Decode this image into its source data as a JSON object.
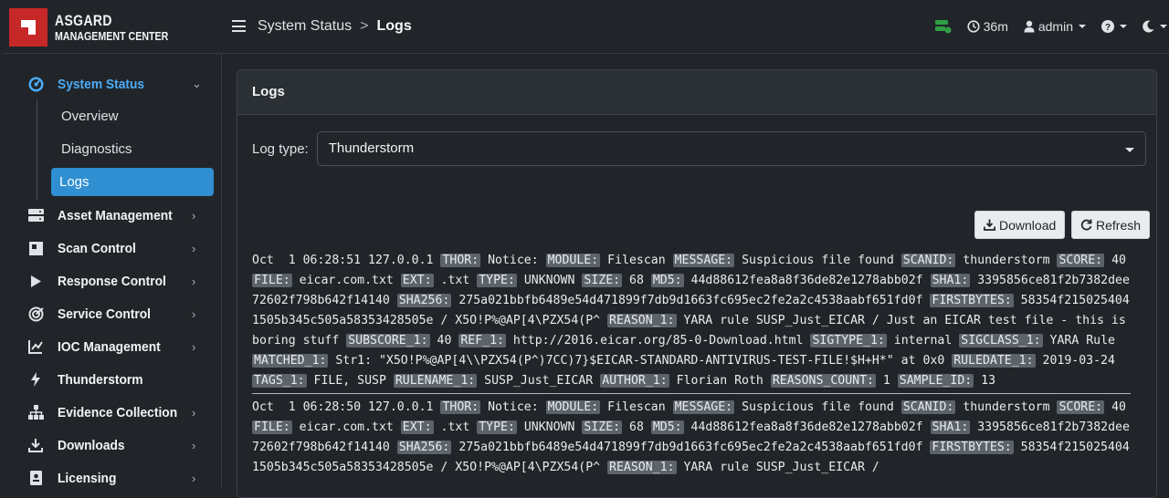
{
  "brand": {
    "line1": "ASGARD",
    "line2": "MANAGEMENT CENTER",
    "color": "#c62828"
  },
  "breadcrumb": {
    "parent": "System Status",
    "separator": ">",
    "current": "Logs"
  },
  "topbar": {
    "session_time": "36m",
    "user": "admin"
  },
  "sidebar": {
    "system_status": {
      "label": "System Status",
      "icon": "dashboard-icon"
    },
    "sub_items": [
      "Overview",
      "Diagnostics",
      "Logs"
    ],
    "items": [
      {
        "label": "Asset Management",
        "icon": "server-icon"
      },
      {
        "label": "Scan Control",
        "icon": "scan-icon"
      },
      {
        "label": "Response Control",
        "icon": "play-icon"
      },
      {
        "label": "Service Control",
        "icon": "radar-icon"
      },
      {
        "label": "IOC Management",
        "icon": "chart-icon"
      },
      {
        "label": "Thunderstorm",
        "icon": "bolt-icon"
      },
      {
        "label": "Evidence Collection",
        "icon": "sitemap-icon"
      },
      {
        "label": "Downloads",
        "icon": "download-icon"
      },
      {
        "label": "Licensing",
        "icon": "id-card-icon"
      }
    ]
  },
  "card": {
    "title": "Logs"
  },
  "log_type": {
    "label": "Log type:",
    "value": "Thunderstorm"
  },
  "buttons": {
    "download": "Download",
    "refresh": "Refresh"
  },
  "log_entries": [
    {
      "time": "Oct  1 06:28:51 127.0.0.1",
      "fields": [
        [
          "THOR:",
          "Notice:"
        ],
        [
          "MODULE:",
          "Filescan"
        ],
        [
          "MESSAGE:",
          "Suspicious file found"
        ],
        [
          "SCANID:",
          "thunderstorm"
        ],
        [
          "SCORE:",
          "40"
        ],
        [
          "FILE:",
          "eicar.com.txt"
        ],
        [
          "EXT:",
          ".txt"
        ],
        [
          "TYPE:",
          "UNKNOWN"
        ],
        [
          "SIZE:",
          "68"
        ],
        [
          "MD5:",
          "44d88612fea8a8f36de82e1278abb02f"
        ],
        [
          "SHA1:",
          "3395856ce81f2b7382dee72602f798b642f14140"
        ],
        [
          "SHA256:",
          "275a021bbfb6489e54d471899f7db9d1663fc695ec2fe2a2c4538aabf651fd0f"
        ],
        [
          "FIRSTBYTES:",
          "58354f2150254041505b345c505a58353428505e / X5O!P%@AP[4\\PZX54(P^"
        ],
        [
          "REASON_1:",
          "YARA rule SUSP_Just_EICAR / Just an EICAR test file - this is boring stuff"
        ],
        [
          "SUBSCORE_1:",
          "40"
        ],
        [
          "REF_1:",
          "http://2016.eicar.org/85-0-Download.html"
        ],
        [
          "SIGTYPE_1:",
          "internal"
        ],
        [
          "SIGCLASS_1:",
          "YARA Rule"
        ],
        [
          "MATCHED_1:",
          "Str1: \"X5O!P%@AP[4\\\\PZX54(P^)7CC)7}$EICAR-STANDARD-ANTIVIRUS-TEST-FILE!$H+H*\" at 0x0"
        ],
        [
          "RULEDATE_1:",
          "2019-03-24"
        ],
        [
          "TAGS_1:",
          "FILE, SUSP"
        ],
        [
          "RULENAME_1:",
          "SUSP_Just_EICAR"
        ],
        [
          "AUTHOR_1:",
          "Florian Roth"
        ],
        [
          "REASONS_COUNT:",
          "1"
        ],
        [
          "SAMPLE_ID:",
          "13"
        ]
      ]
    },
    {
      "time": "Oct  1 06:28:50 127.0.0.1",
      "fields": [
        [
          "THOR:",
          "Notice:"
        ],
        [
          "MODULE:",
          "Filescan"
        ],
        [
          "MESSAGE:",
          "Suspicious file found"
        ],
        [
          "SCANID:",
          "thunderstorm"
        ],
        [
          "SCORE:",
          "40"
        ],
        [
          "FILE:",
          "eicar.com.txt"
        ],
        [
          "EXT:",
          ".txt"
        ],
        [
          "TYPE:",
          "UNKNOWN"
        ],
        [
          "SIZE:",
          "68"
        ],
        [
          "MD5:",
          "44d88612fea8a8f36de82e1278abb02f"
        ],
        [
          "SHA1:",
          "3395856ce81f2b7382dee72602f798b642f14140"
        ],
        [
          "SHA256:",
          "275a021bbfb6489e54d471899f7db9d1663fc695ec2fe2a2c4538aabf651fd0f"
        ],
        [
          "FIRSTBYTES:",
          "58354f2150254041505b345c505a58353428505e / X5O!P%@AP[4\\PZX54(P^"
        ],
        [
          "REASON_1:",
          "YARA rule SUSP_Just_EICAR /"
        ]
      ]
    }
  ]
}
